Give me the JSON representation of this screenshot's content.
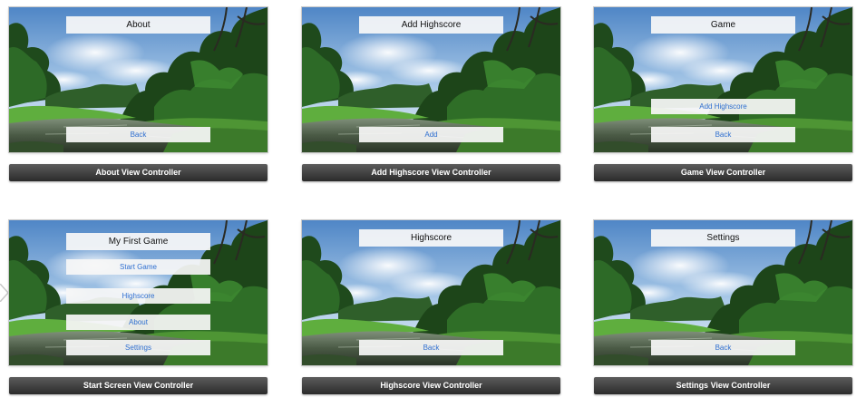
{
  "storyboard": {
    "scenes": [
      {
        "id": "about",
        "title": "About",
        "buttons": [
          "Back"
        ],
        "caption": "About View Controller"
      },
      {
        "id": "add-highscore",
        "title": "Add Highscore",
        "buttons": [
          "Add"
        ],
        "caption": "Add Highscore View Controller"
      },
      {
        "id": "game",
        "title": "Game",
        "buttons": [
          "Add Highscore",
          "Back"
        ],
        "caption": "Game View Controller"
      },
      {
        "id": "start-screen",
        "title": "My First Game",
        "buttons": [
          "Start Game",
          "Highscore",
          "About",
          "Settings"
        ],
        "caption": "Start Screen View Controller"
      },
      {
        "id": "highscore",
        "title": "Highscore",
        "buttons": [
          "Back"
        ],
        "caption": "Highscore View Controller"
      },
      {
        "id": "settings",
        "title": "Settings",
        "buttons": [
          "Back"
        ],
        "caption": "Settings View Controller"
      }
    ]
  },
  "colors": {
    "button_text": "#2f6fd0",
    "caption_bar_top": "#5c5c5c",
    "caption_bar_bottom": "#2b2b2b"
  },
  "icons": {
    "entry_point": "initial-scene-arrow-icon"
  }
}
